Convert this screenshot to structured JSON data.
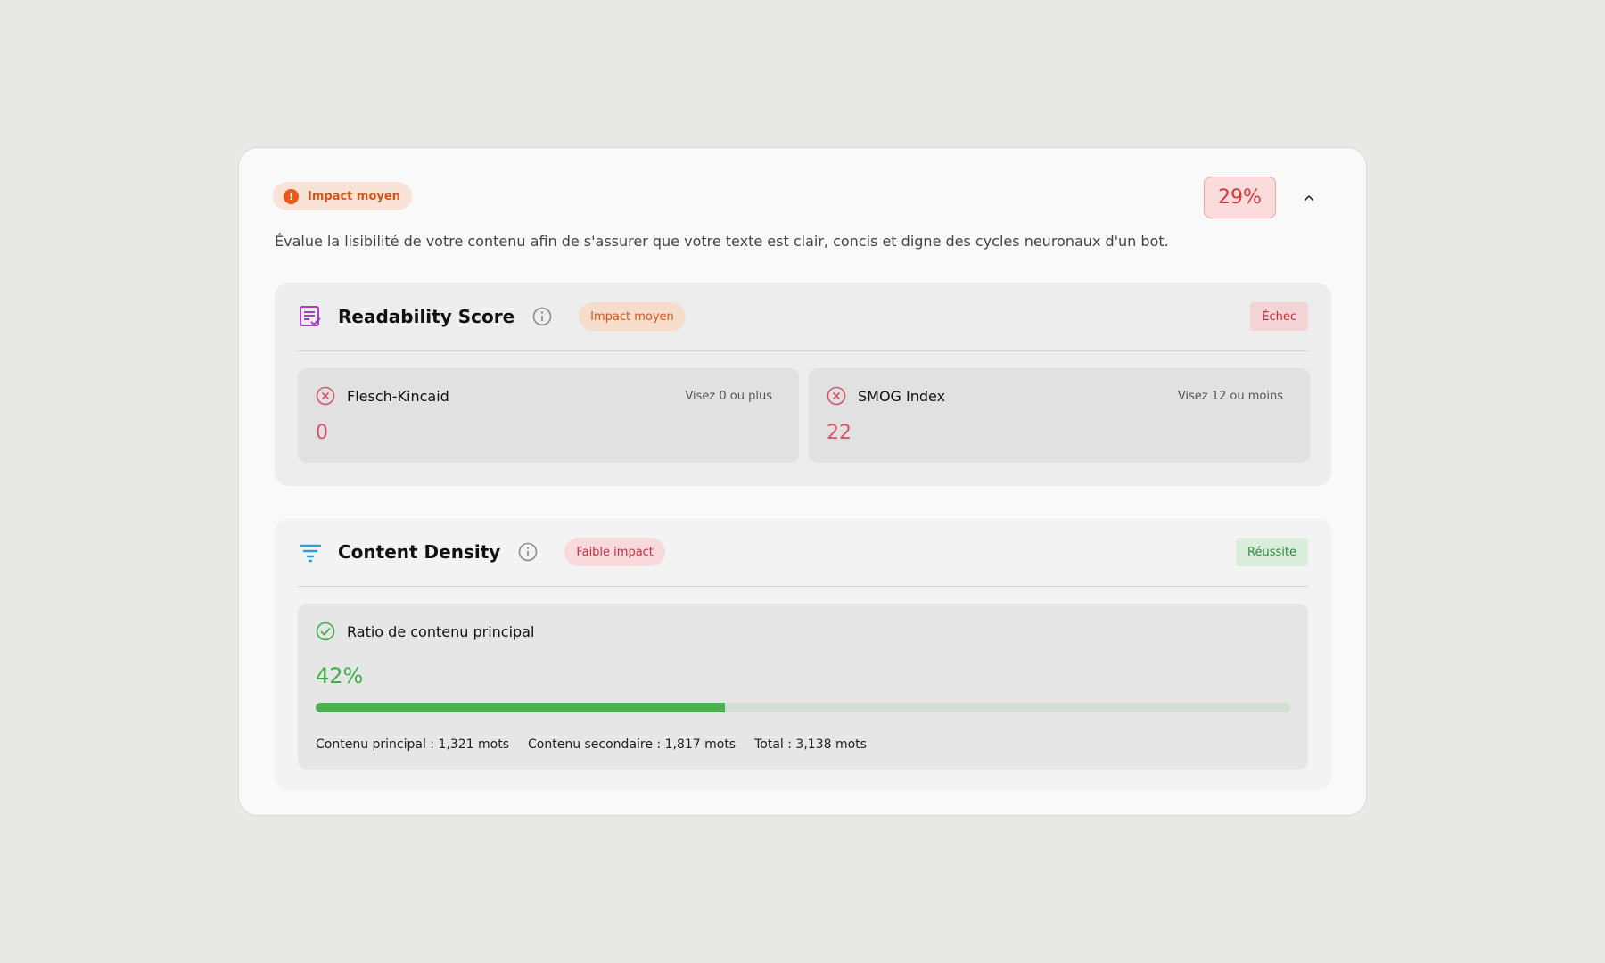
{
  "header": {
    "impact_label": "Impact moyen",
    "score": "29%",
    "description": "Évalue la lisibilité de votre contenu afin de s'assurer que votre texte est clair, concis et digne des cycles neuronaux d'un bot."
  },
  "readability": {
    "title": "Readability Score",
    "impact_label": "Impact moyen",
    "status": "Échec",
    "metrics": [
      {
        "name": "Flesch-Kincaid",
        "target": "Visez 0 ou plus",
        "value": "0"
      },
      {
        "name": "SMOG Index",
        "target": "Visez 12 ou moins",
        "value": "22"
      }
    ]
  },
  "density": {
    "title": "Content Density",
    "impact_label": "Faible impact",
    "status": "Réussite",
    "ratio": {
      "label": "Ratio de contenu principal",
      "value": "42%",
      "progress_percent": 42,
      "stats": {
        "main": "Contenu principal : 1,321 mots",
        "secondary": "Contenu secondaire : 1,817 mots",
        "total": "Total : 3,138 mots"
      }
    }
  },
  "colors": {
    "medium_impact": "#d4541a",
    "low_impact": "#c03040",
    "fail": "#d4556a",
    "pass": "#3fae4a"
  },
  "icons": {
    "header_impact": "exclamation-circle-icon",
    "readability": "checklist-document-icon",
    "density": "filter-icon",
    "info": "info-icon",
    "fail": "x-circle-icon",
    "pass": "check-circle-icon",
    "collapse": "chevron-up-icon"
  }
}
